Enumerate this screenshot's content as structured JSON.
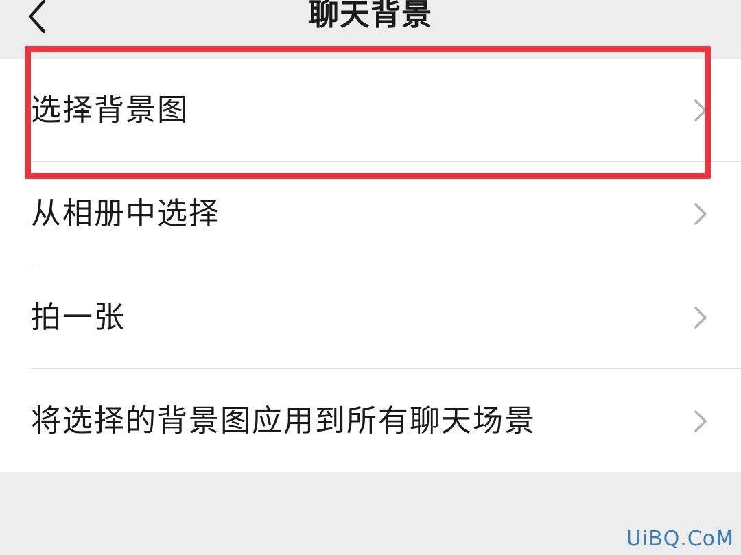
{
  "header": {
    "title": "聊天背景",
    "back_icon": "chevron-left-icon"
  },
  "menu": {
    "items": [
      {
        "label": "选择背景图",
        "icon": "chevron-right-icon",
        "highlighted": true
      },
      {
        "label": "从相册中选择",
        "icon": "chevron-right-icon"
      },
      {
        "label": "拍一张",
        "icon": "chevron-right-icon"
      },
      {
        "label": "将选择的背景图应用到所有聊天场景",
        "icon": "chevron-right-icon"
      }
    ]
  },
  "highlight": {
    "color": "#e8353f"
  },
  "watermark": {
    "text": "UiBQ.CoM"
  }
}
